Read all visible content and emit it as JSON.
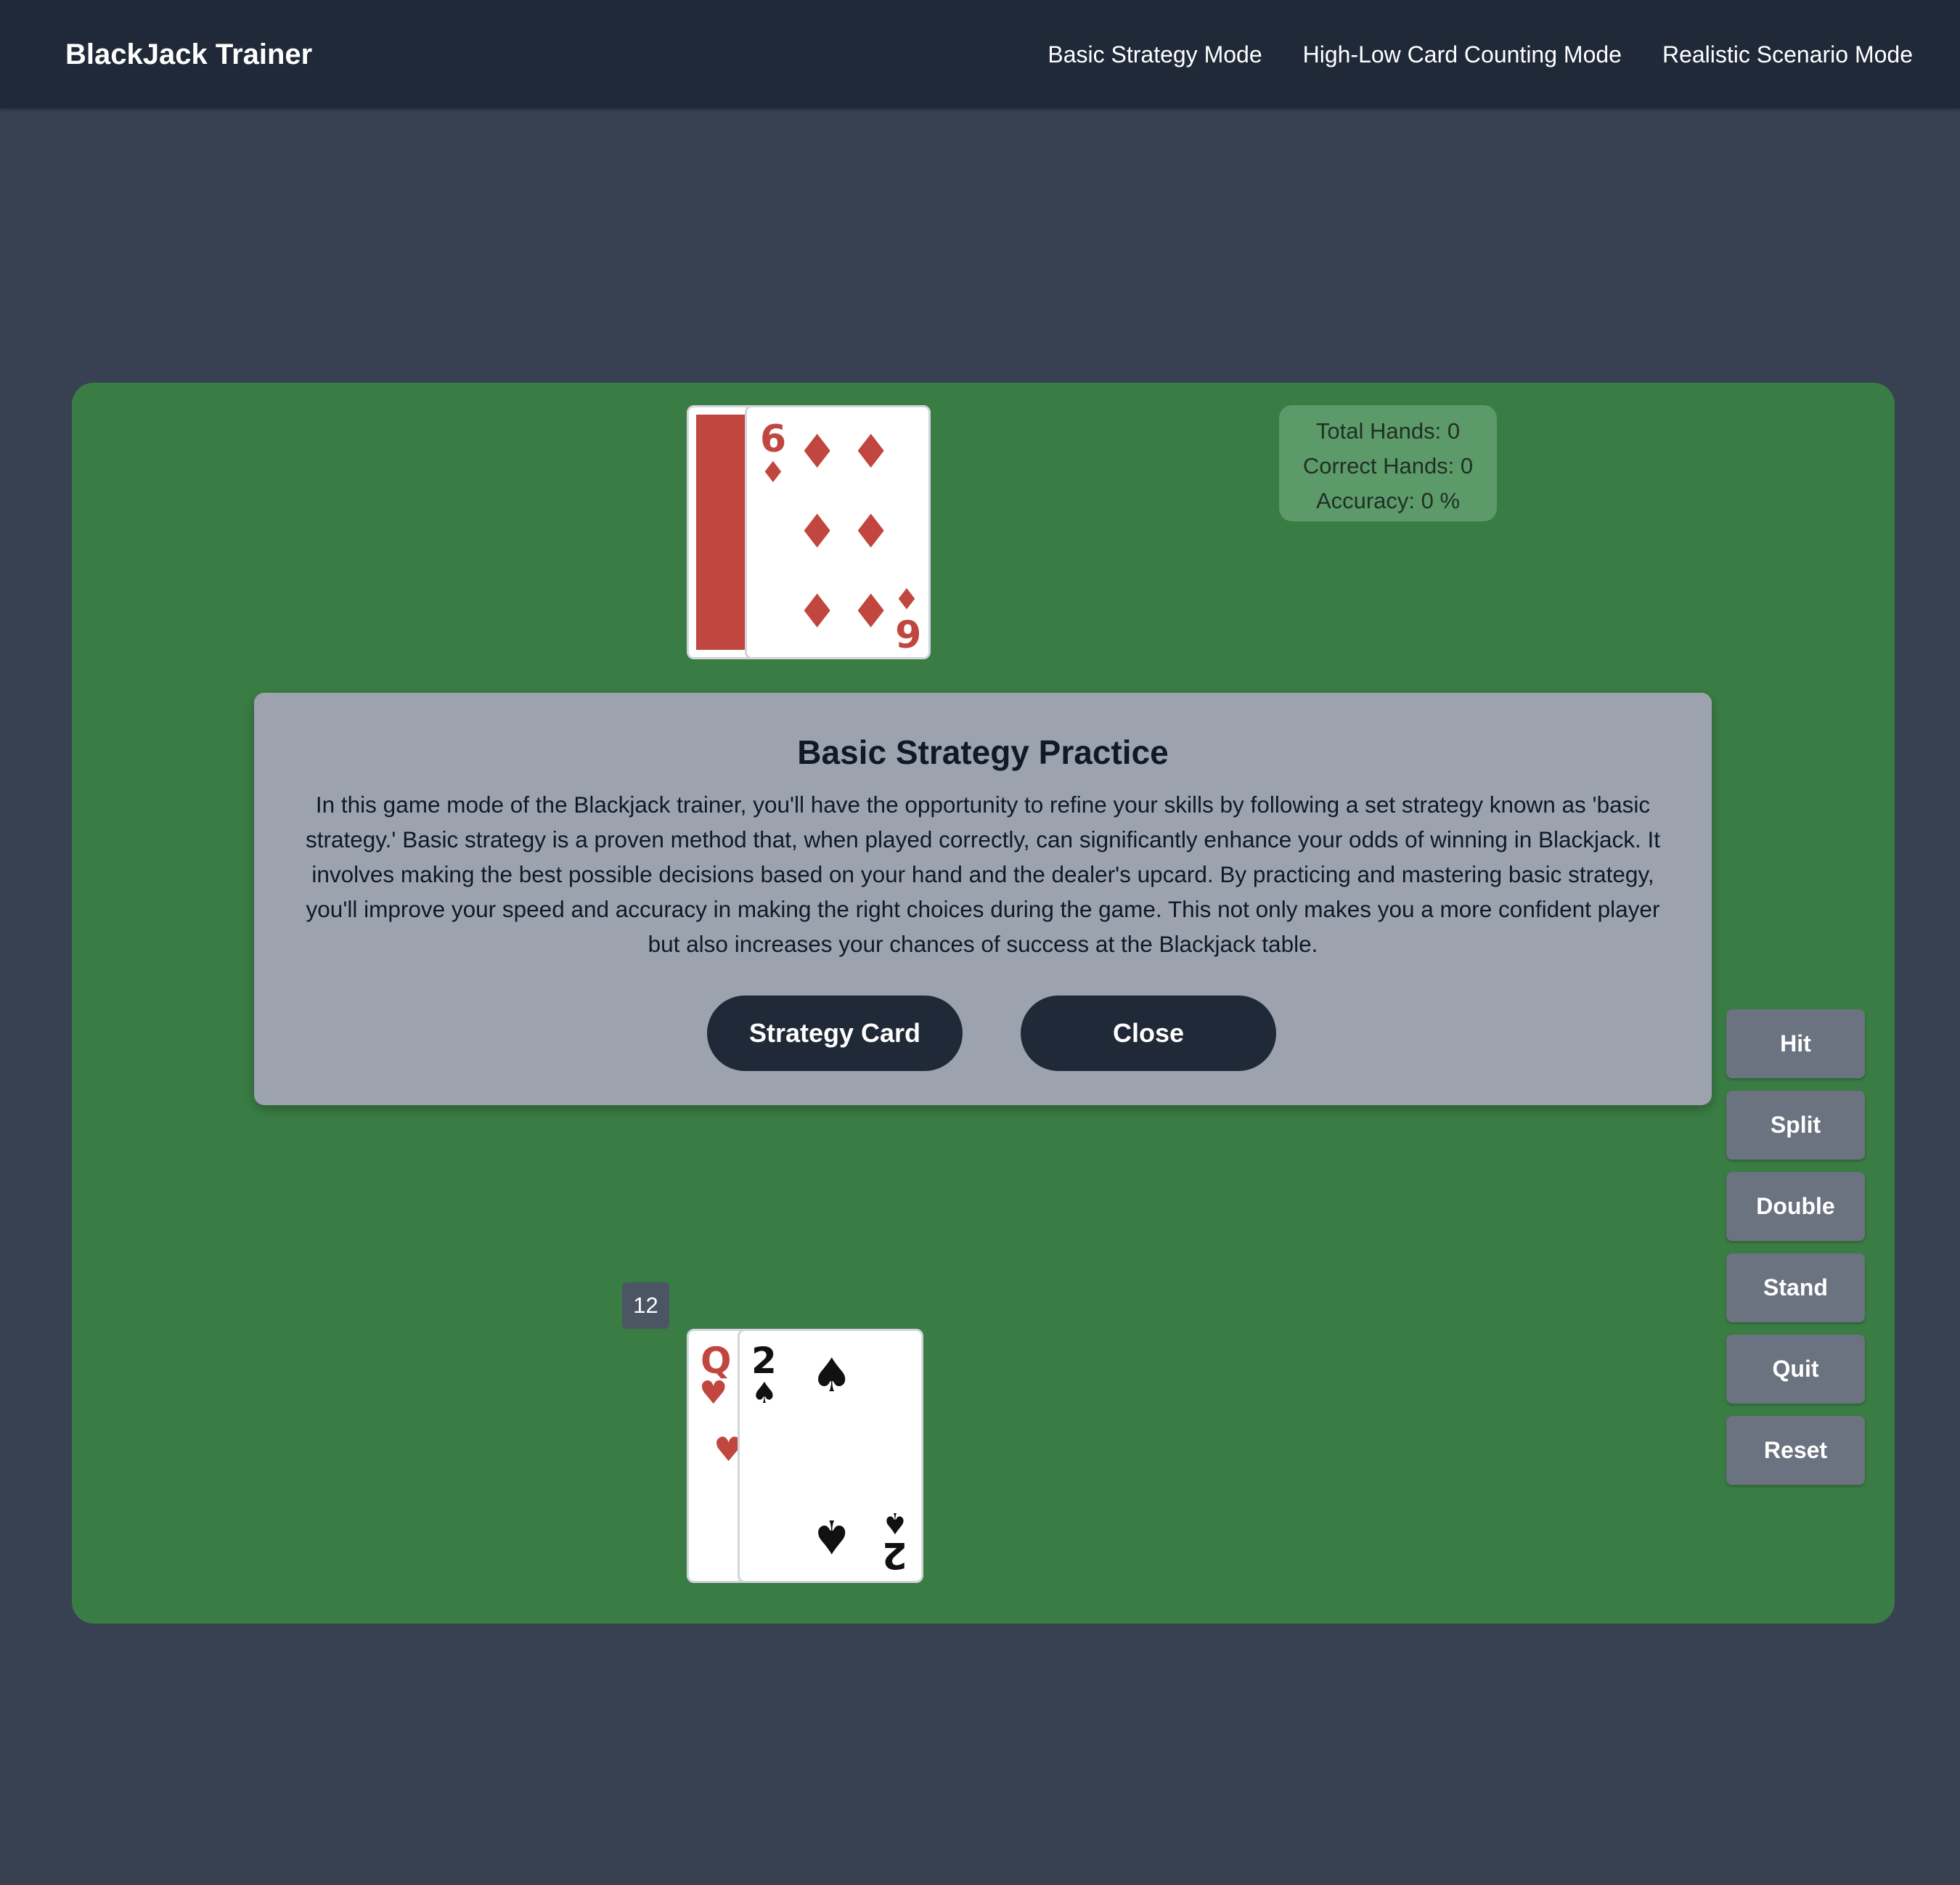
{
  "navbar": {
    "brand": "BlackJack Trainer",
    "links": [
      "Basic Strategy Mode",
      "High-Low Card Counting Mode",
      "Realistic Scenario Mode"
    ]
  },
  "stats": {
    "total_hands": "Total Hands: 0",
    "correct_hands": "Correct Hands: 0",
    "accuracy": "Accuracy: 0 %"
  },
  "dealer": {
    "cards": [
      {
        "face": "down"
      },
      {
        "rank": "6",
        "suit": "diamonds",
        "suit_symbol": "♦",
        "color": "#c0463f"
      }
    ]
  },
  "modal": {
    "title": "Basic Strategy Practice",
    "text": "In this game mode of the Blackjack trainer, you'll have the opportunity to refine your skills by following a set strategy known as 'basic strategy.' Basic strategy is a proven method that, when played correctly, can significantly enhance your odds of winning in Blackjack. It involves making the best possible decisions based on your hand and the dealer's upcard. By practicing and mastering basic strategy, you'll improve your speed and accuracy in making the right choices during the game. This not only makes you a more confident player but also increases your chances of success at the Blackjack table.",
    "strategy_card_label": "Strategy Card",
    "close_label": "Close"
  },
  "player": {
    "score": "12",
    "cards": [
      {
        "rank": "Q",
        "suit": "hearts",
        "suit_symbol": "♥",
        "color": "#c0463f"
      },
      {
        "rank": "2",
        "suit": "spades",
        "suit_symbol": "♠",
        "color": "#111111"
      }
    ]
  },
  "actions": {
    "hit": "Hit",
    "split": "Split",
    "double": "Double",
    "stand": "Stand",
    "quit": "Quit",
    "reset": "Reset"
  },
  "colors": {
    "background": "#374151",
    "navbar": "#1f2937",
    "table": "#3a7d44",
    "modal": "#9ca3af",
    "button": "#6b7280",
    "card_red": "#c0463f"
  }
}
